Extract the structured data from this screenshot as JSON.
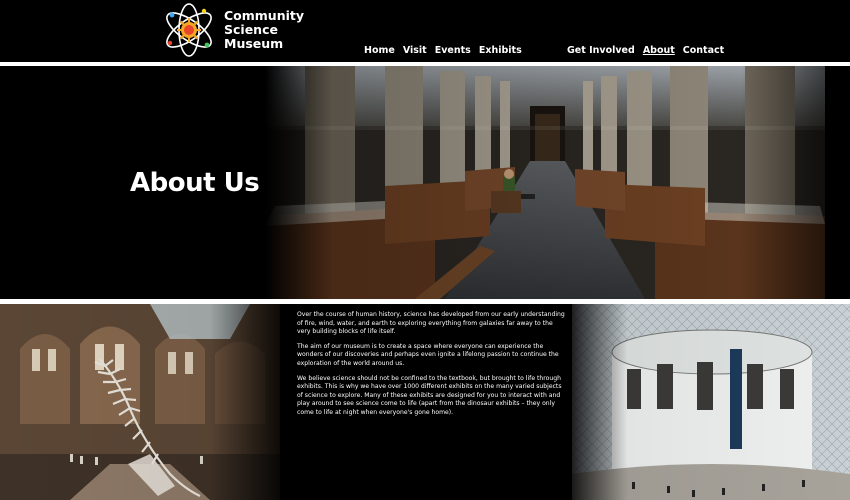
{
  "brand": {
    "line1": "Community",
    "line2": "Science",
    "line3": "Museum",
    "logo_icon": "atom-sun-icon",
    "colors": {
      "sun": "#f5a623",
      "core": "#e8452c",
      "orbit": "#ffffff",
      "electron_blue": "#3fa9f5",
      "electron_green": "#46c35a",
      "electron_yellow": "#f7d117"
    }
  },
  "nav": {
    "primary": [
      {
        "label": "Home"
      },
      {
        "label": "Visit"
      },
      {
        "label": "Events"
      },
      {
        "label": "Exhibits"
      }
    ],
    "secondary": [
      {
        "label": "Get Involved"
      },
      {
        "label": "About",
        "active": true
      },
      {
        "label": "Contact"
      }
    ]
  },
  "hero": {
    "title": "About Us",
    "image": "museum-gallery-hall-photo"
  },
  "about": {
    "paragraphs": [
      "Over the course of human history, science has developed from our early understanding of fire, wind, water, and earth to exploring everything from galaxies far away to the very building blocks of life itself.",
      "The aim of our museum is to create a space where everyone can experience the wonders of our discoveries and perhaps even ignite a lifelong passion to continue the exploration of the world around us.",
      "We believe science should not be confined to the textbook, but brought to life through exhibits. This is why we have over 1000 different exhibits on the many varied subjects of science to explore. Many of these exhibits are designed for you to interact with and play around to see science come to life (apart from the dinosaur exhibits – they only come to life at night when everyone's gone home)."
    ],
    "left_image": "whale-skeleton-hall-photo",
    "right_image": "glass-roof-rotunda-photo"
  },
  "colors": {
    "background": "#000000",
    "divider": "#ffffff",
    "text": "#ffffff"
  }
}
